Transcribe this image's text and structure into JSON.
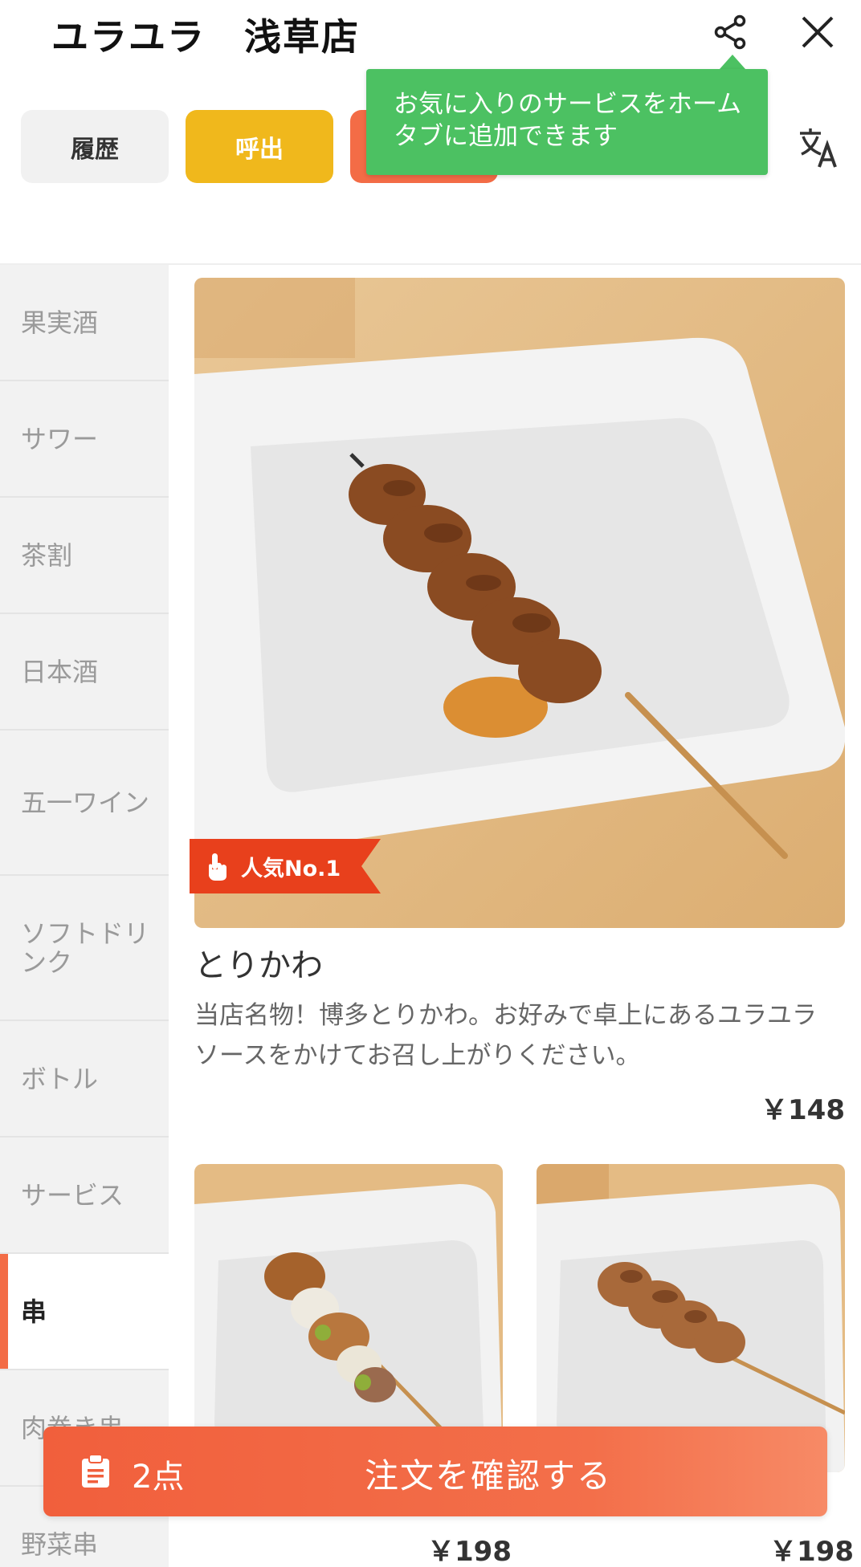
{
  "header": {
    "title": "ユラユラ　浅草店",
    "share_icon": "share-icon",
    "close_icon": "close-icon",
    "translate_icon": "translate-icon"
  },
  "actions": {
    "history_label": "履歴",
    "call_label": "呼出"
  },
  "tooltip": {
    "text": "お気に入りのサービスをホームタブに追加できます"
  },
  "sidebar": {
    "items": [
      {
        "label": "果実酒"
      },
      {
        "label": "サワー"
      },
      {
        "label": "茶割"
      },
      {
        "label": "日本酒"
      },
      {
        "label": "五一ワイン"
      },
      {
        "label": "ソフトドリンク"
      },
      {
        "label": "ボトル"
      },
      {
        "label": "サービス"
      },
      {
        "label": "串"
      },
      {
        "label": "肉巻き串"
      },
      {
        "label": "野菜串"
      }
    ],
    "active_index": 8
  },
  "featured": {
    "badge": "人気No.1",
    "name": "とりかわ",
    "description": "当店名物！博多とりかわ。お好みで卓上にあるユラユラソースをかけてお召し上がりください。",
    "price": "￥148"
  },
  "cards": [
    {
      "price": "￥198"
    },
    {
      "price": "￥198"
    }
  ],
  "order_bar": {
    "count": "2点",
    "label": "注文を確認する"
  },
  "colors": {
    "accent": "#f36c46",
    "call_yellow": "#f0b81c",
    "tooltip_green": "#4cc162"
  }
}
